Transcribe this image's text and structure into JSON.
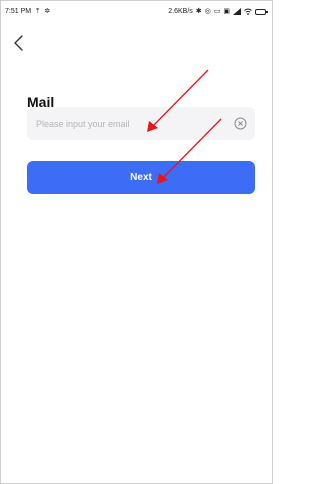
{
  "status_bar": {
    "time": "7:51 PM",
    "network_speed": "2.6KB/s",
    "icons": [
      "upload-icon",
      "settings-icon",
      "bluetooth-icon",
      "alarm-icon",
      "mail-icon",
      "cast-icon",
      "signal-icon",
      "wifi-icon",
      "battery-icon"
    ]
  },
  "header": {
    "back_icon": "chevron-left-icon"
  },
  "form": {
    "title": "Mail",
    "email_placeholder": "Please input your email",
    "email_value": "",
    "clear_icon": "clear-circle-icon",
    "next_label": "Next"
  },
  "colors": {
    "accent": "#3d6cf7",
    "input_bg": "#f4f4f6",
    "annotation_arrow": "#e8141c"
  }
}
